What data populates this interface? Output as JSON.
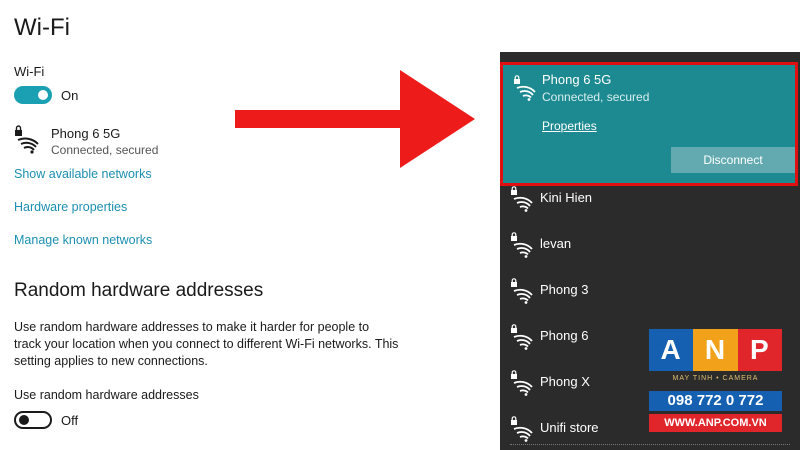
{
  "settings": {
    "title": "Wi-Fi",
    "wifi_label": "Wi-Fi",
    "wifi_toggle_state": "On",
    "current_network": {
      "name": "Phong 6 5G",
      "status": "Connected, secured"
    },
    "links": {
      "show_networks": "Show available networks",
      "hardware_properties": "Hardware properties",
      "manage_known": "Manage known networks"
    },
    "random_section": {
      "heading": "Random hardware addresses",
      "description": "Use random hardware addresses to make it harder for people to track your location when you connect to different Wi-Fi networks. This setting applies to new connections.",
      "toggle_label": "Use random hardware addresses",
      "toggle_state": "Off"
    },
    "accent_color": "#1aa0b2"
  },
  "flyout": {
    "selected": {
      "name": "Phong 6 5G",
      "status": "Connected, secured",
      "properties_label": "Properties",
      "disconnect_label": "Disconnect"
    },
    "networks": [
      {
        "name": "Kini Hien",
        "icon": "wifi-secured-icon"
      },
      {
        "name": "levan",
        "icon": "wifi-secured-icon"
      },
      {
        "name": "Phong 3",
        "icon": "wifi-secured-icon"
      },
      {
        "name": "Phong 6",
        "icon": "wifi-secured-icon"
      },
      {
        "name": "Phong X",
        "icon": "wifi-secured-icon"
      },
      {
        "name": "Unifi store",
        "icon": "wifi-secured-icon"
      }
    ],
    "highlight_color": "#e01010"
  },
  "watermark": {
    "letters": [
      "A",
      "N",
      "P"
    ],
    "tagline": "MAY TINH • CAMERA",
    "phone": "098 772 0 772",
    "url": "WWW.ANP.COM.VN"
  }
}
